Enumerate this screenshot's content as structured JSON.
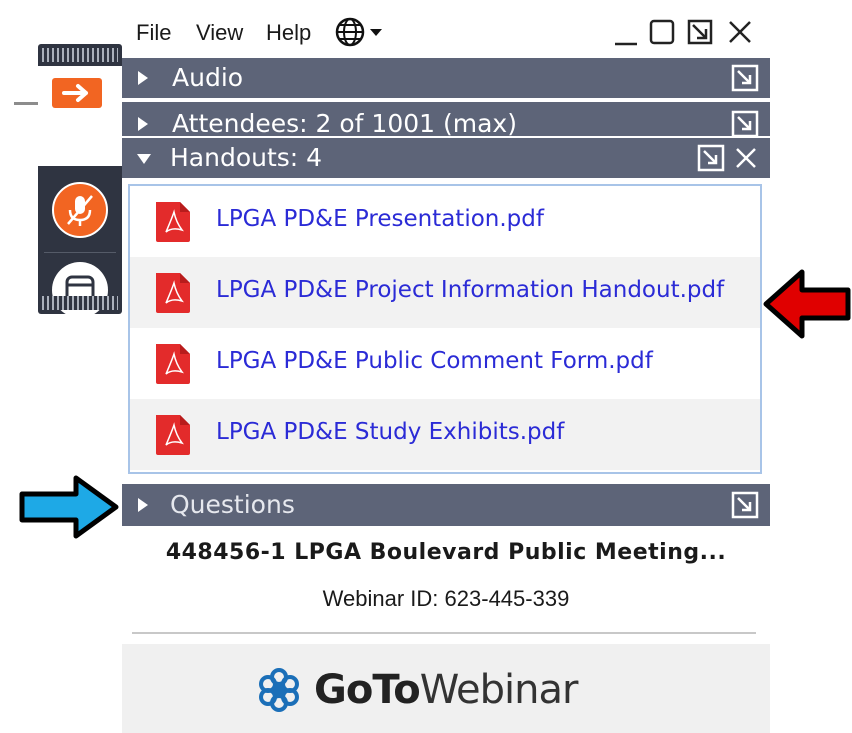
{
  "menu": {
    "file": "File",
    "view": "View",
    "help": "Help"
  },
  "panels": {
    "audio": "Audio",
    "attendees": "Attendees:  2 of 1001 (max)",
    "handouts": "Handouts: 4",
    "questions": "Questions"
  },
  "handouts": [
    "LPGA PD&E Presentation.pdf",
    "LPGA PD&E Project Information Handout.pdf",
    "LPGA PD&E Public Comment Form.pdf",
    "LPGA PD&E Study Exhibits.pdf"
  ],
  "meeting": {
    "title": "448456-1 LPGA Boulevard Public Meeting...",
    "webinar_id": "Webinar ID: 623-445-339"
  },
  "brand": {
    "goto": "GoTo",
    "webinar": "Webinar"
  },
  "colors": {
    "panel_bar": "#5d6478",
    "link": "#2b2bd6",
    "orange": "#f26522",
    "pdf_red": "#e32b2b",
    "callout_red": "#e00000",
    "callout_blue": "#1ea9e6"
  },
  "icons": {
    "globe": "globe-icon",
    "minimize": "minimize-icon",
    "maximize": "maximize-icon",
    "popout": "popout-icon",
    "close": "close-icon",
    "expand": "triangle-right-icon",
    "collapse": "triangle-down-icon",
    "pdf": "pdf-icon"
  }
}
